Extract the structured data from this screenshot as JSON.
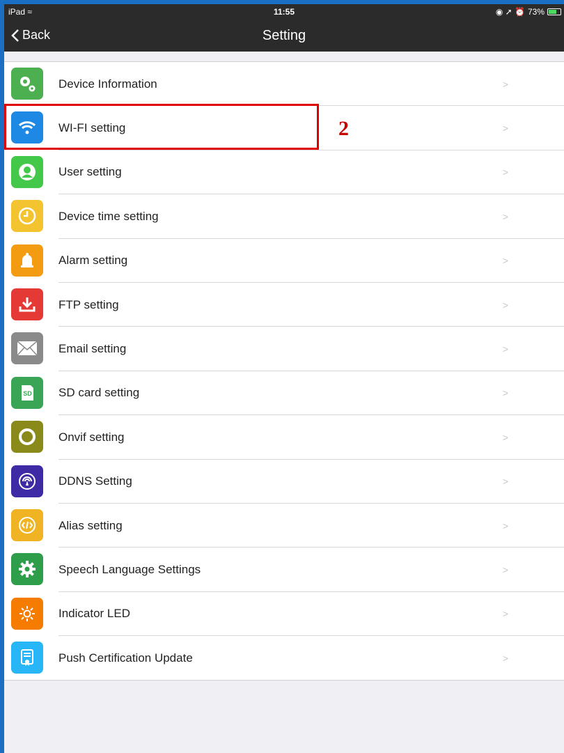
{
  "status_bar": {
    "device": "iPad",
    "time": "11:55",
    "battery": "73%"
  },
  "nav": {
    "back_label": "Back",
    "title": "Setting"
  },
  "settings": [
    {
      "label": "Device Information",
      "icon": "gears-icon",
      "color": "#4caf50"
    },
    {
      "label": "WI-FI setting",
      "icon": "wifi-icon",
      "color": "#1e88e5"
    },
    {
      "label": "User setting",
      "icon": "user-icon",
      "color": "#43c84a"
    },
    {
      "label": "Device time setting",
      "icon": "clock-icon",
      "color": "#f4c430"
    },
    {
      "label": "Alarm setting",
      "icon": "bell-icon",
      "color": "#f39c12"
    },
    {
      "label": "FTP setting",
      "icon": "download-icon",
      "color": "#e53935"
    },
    {
      "label": "Email setting",
      "icon": "envelope-icon",
      "color": "#8a8a8a"
    },
    {
      "label": "SD card setting",
      "icon": "sd-card-icon",
      "color": "#3aa655"
    },
    {
      "label": "Onvif setting",
      "icon": "ring-icon",
      "color": "#8a8a1a"
    },
    {
      "label": "DDNS Setting",
      "icon": "signal-icon",
      "color": "#3f2aa6"
    },
    {
      "label": "Alias setting",
      "icon": "code-icon",
      "color": "#f0b323"
    },
    {
      "label": "Speech Language Settings",
      "icon": "gear-icon",
      "color": "#2e9e4a"
    },
    {
      "label": "Indicator LED",
      "icon": "sun-icon",
      "color": "#f57c00"
    },
    {
      "label": "Push Certification Update",
      "icon": "certificate-icon",
      "color": "#29b6f6"
    }
  ],
  "annotation": {
    "text": "2"
  }
}
